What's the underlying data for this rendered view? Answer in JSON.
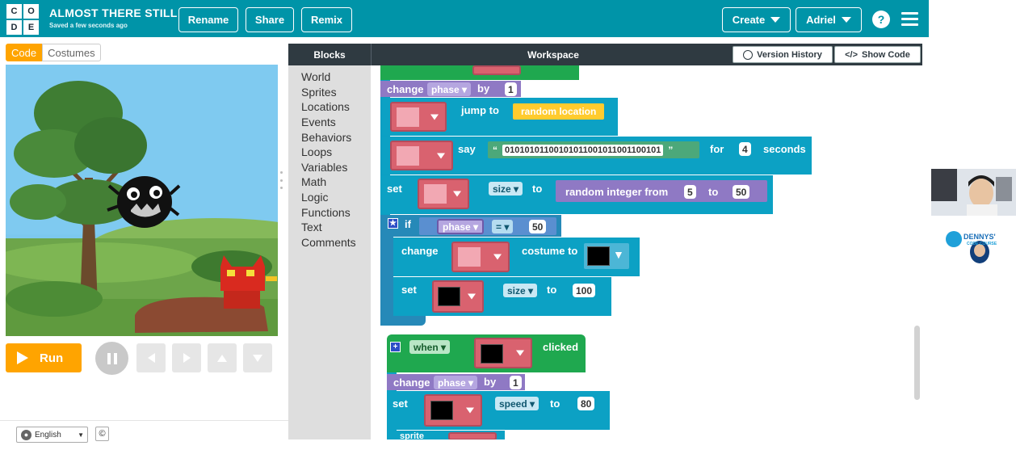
{
  "header": {
    "logo_letters": [
      "C",
      "O",
      "D",
      "E"
    ],
    "project_title": "ALMOST THERE STILL",
    "saved_status": "Saved a few seconds ago",
    "buttons": {
      "rename": "Rename",
      "share": "Share",
      "remix": "Remix"
    },
    "create_label": "Create",
    "user_label": "Adriel",
    "help_label": "?"
  },
  "left_tabs": {
    "code": "Code",
    "costumes": "Costumes"
  },
  "controls": {
    "run_label": "Run"
  },
  "footer": {
    "language": "English",
    "copyright": "©"
  },
  "workspace_header": {
    "blocks_label": "Blocks",
    "workspace_label": "Workspace",
    "version_history": "Version History",
    "show_code": "Show Code"
  },
  "toolbox": {
    "categories": [
      "World",
      "Sprites",
      "Locations",
      "Events",
      "Behaviors",
      "Loops",
      "Variables",
      "Math",
      "Logic",
      "Functions",
      "Text",
      "Comments"
    ]
  },
  "blocks": {
    "change_phase_1": {
      "kw": "change",
      "var": "phase",
      "by": "by",
      "val": "1"
    },
    "jump": {
      "kw": "jump to",
      "target": "random location"
    },
    "say": {
      "kw": "say",
      "quote_open": "“",
      "text": "0101010110010101100101100110010​1",
      "quote_close": "”",
      "for": "for",
      "val": "4",
      "unit": "seconds"
    },
    "set_size": {
      "kw": "set",
      "prop": "size",
      "to": "to",
      "expr": "random integer from",
      "from": "5",
      "to2": "to",
      "max": "50"
    },
    "if": {
      "kw": "if",
      "var": "phase",
      "op": "=",
      "val": "50"
    },
    "change_costume": {
      "kw": "change",
      "label": "costume to"
    },
    "set_size_100": {
      "kw": "set",
      "prop": "size",
      "to": "to",
      "val": "100"
    },
    "when_clicked": {
      "kw": "when",
      "label": "clicked"
    },
    "change_phase_2": {
      "kw": "change",
      "var": "phase",
      "by": "by",
      "val": "1"
    },
    "set_speed": {
      "kw": "set",
      "prop": "speed",
      "to": "to",
      "val": "80"
    },
    "sprite_cut": {
      "kw": "sprite"
    }
  },
  "colors": {
    "topbar": "#0094a8",
    "accent_orange": "#ffa400",
    "block_teal": "#0ca1c4",
    "block_purple": "#8f79c4",
    "block_green": "#1fa84f",
    "header_dark": "#2f3a41"
  },
  "overlay": {
    "webcam_logo": "DENNYS'",
    "webcam_sub": "CODE COURSE"
  }
}
